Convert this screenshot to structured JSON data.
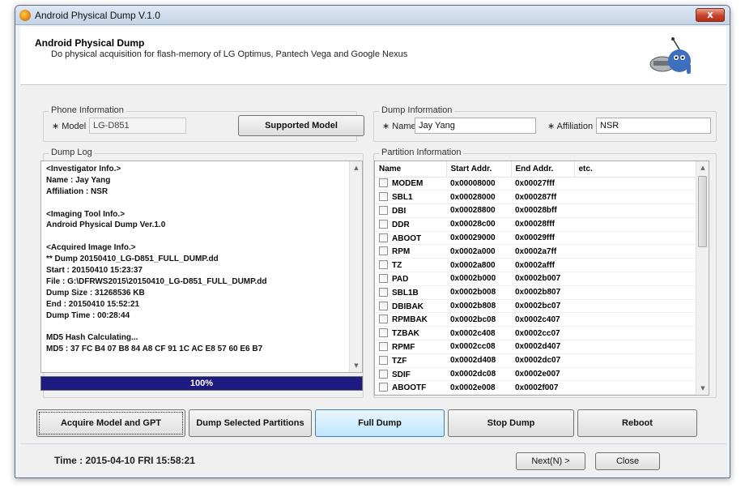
{
  "window": {
    "title": "Android Physical Dump V.1.0",
    "close_label": "x"
  },
  "header": {
    "title": "Android Physical Dump",
    "subtitle": "Do physical acquisition for flash-memory of LG Optimus, Pantech Vega and Google Nexus"
  },
  "phone_info": {
    "legend": "Phone Information",
    "model_label": "∗ Model",
    "model_value": "LG-D851",
    "supported_button": "Supported Model"
  },
  "dump_info": {
    "legend": "Dump Information",
    "name_label": "∗ Name",
    "name_value": "Jay Yang",
    "affiliation_label": "∗ Affiliation",
    "affiliation_value": "NSR"
  },
  "dump_log": {
    "legend": "Dump Log",
    "lines": [
      "<Investigator Info.>",
      "Name : Jay Yang",
      "Affiliation : NSR",
      "",
      "<Imaging Tool Info.>",
      "Android Physical Dump Ver.1.0",
      "",
      "<Acquired Image Info.>",
      "** Dump 20150410_LG-D851_FULL_DUMP.dd",
      "Start : 20150410 15:23:37",
      "File : G:\\DFRWS2015\\20150410_LG-D851_FULL_DUMP.dd",
      "Dump Size : 31268536 KB",
      "End : 20150410 15:52:21",
      "Dump Time : 00:28:44",
      "",
      "MD5 Hash Calculating...",
      "MD5 : 37 FC B4 07 B8 84 A8 CF 91 1C AC E8 57 60 E6 B7"
    ],
    "progress_percent": 100,
    "progress_label": "100%"
  },
  "partition_info": {
    "legend": "Partition Information",
    "columns": [
      "Name",
      "Start Addr.",
      "End Addr.",
      "etc."
    ],
    "rows": [
      {
        "name": "MODEM",
        "start": "0x00008000",
        "end": "0x00027fff"
      },
      {
        "name": "SBL1",
        "start": "0x00028000",
        "end": "0x000287ff"
      },
      {
        "name": "DBI",
        "start": "0x00028800",
        "end": "0x00028bff"
      },
      {
        "name": "DDR",
        "start": "0x00028c00",
        "end": "0x00028fff"
      },
      {
        "name": "ABOOT",
        "start": "0x00029000",
        "end": "0x00029fff"
      },
      {
        "name": "RPM",
        "start": "0x0002a000",
        "end": "0x0002a7ff"
      },
      {
        "name": "TZ",
        "start": "0x0002a800",
        "end": "0x0002afff"
      },
      {
        "name": "PAD",
        "start": "0x0002b000",
        "end": "0x0002b007"
      },
      {
        "name": "SBL1B",
        "start": "0x0002b008",
        "end": "0x0002b807"
      },
      {
        "name": "DBIBAK",
        "start": "0x0002b808",
        "end": "0x0002bc07"
      },
      {
        "name": "RPMBAK",
        "start": "0x0002bc08",
        "end": "0x0002c407"
      },
      {
        "name": "TZBAK",
        "start": "0x0002c408",
        "end": "0x0002cc07"
      },
      {
        "name": "RPMF",
        "start": "0x0002cc08",
        "end": "0x0002d407"
      },
      {
        "name": "TZF",
        "start": "0x0002d408",
        "end": "0x0002dc07"
      },
      {
        "name": "SDIF",
        "start": "0x0002dc08",
        "end": "0x0002e007"
      },
      {
        "name": "ABOOTF",
        "start": "0x0002e008",
        "end": "0x0002f007"
      }
    ]
  },
  "actions": {
    "acquire": "Acquire Model and GPT information",
    "dump_selected": "Dump Selected Partitions",
    "full_dump": "Full Dump",
    "stop_dump": "Stop Dump",
    "reboot": "Reboot"
  },
  "status": {
    "time": "Time : 2015-04-10 FRI 15:58:21",
    "next_button": "Next(N) >",
    "close_button": "Close"
  },
  "colors": {
    "progress_fill": "#1d1a80",
    "window_border": "#5a6f8c"
  },
  "icons": [
    "app-icon",
    "close-icon",
    "android-robot-logo",
    "scroll-up-icon",
    "scroll-down-icon",
    "checkbox-icon"
  ]
}
